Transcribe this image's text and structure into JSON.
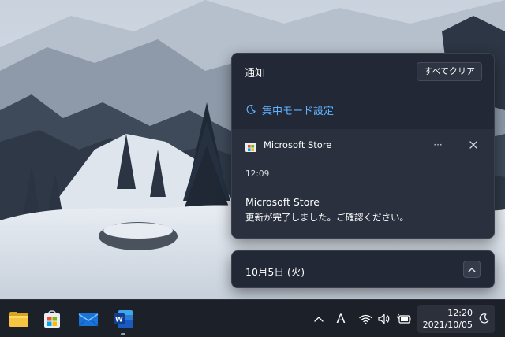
{
  "notification_center": {
    "title": "通知",
    "clear_all_label": "すべてクリア",
    "focus_assist_label": "集中モード設定",
    "notification": {
      "app_name": "Microsoft Store",
      "more_label": "···",
      "time": "12:09",
      "title": "Microsoft Store",
      "body": "更新が完了しました。ご確認ください。"
    }
  },
  "calendar": {
    "date_label": "10月5日 (火)"
  },
  "taskbar": {
    "apps": [
      "file-explorer-icon",
      "microsoft-store-icon",
      "mail-icon",
      "word-icon"
    ],
    "ime_label": "A",
    "clock_time": "12:20",
    "clock_date": "2021/10/05"
  },
  "colors": {
    "accent": "#5fb3ff",
    "panel_bg": "#232836",
    "taskbar_bg": "#1c2029"
  }
}
